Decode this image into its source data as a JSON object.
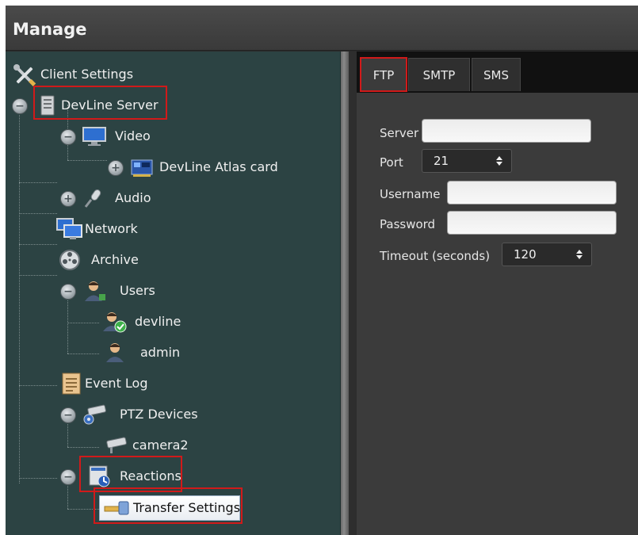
{
  "window": {
    "title": "Manage"
  },
  "tree": {
    "client_settings": "Client Settings",
    "devline_server": "DevLine Server",
    "video": "Video",
    "atlas_card": "DevLine Atlas card",
    "audio": "Audio",
    "network": "Network",
    "archive": "Archive",
    "users": "Users",
    "user_devline": "devline",
    "user_admin": "admin",
    "event_log": "Event Log",
    "ptz_devices": "PTZ Devices",
    "camera2": "camera2",
    "reactions": "Reactions",
    "transfer_settings": "Transfer Settings",
    "toggle_collapse": "−",
    "toggle_expand": "+"
  },
  "tabs": [
    "FTP",
    "SMTP",
    "SMS"
  ],
  "ftp_form": {
    "server_label": "Server",
    "server_value": "",
    "port_label": "Port",
    "port_value": "21",
    "username_label": "Username",
    "username_value": "",
    "password_label": "Password",
    "password_value": "",
    "timeout_label": "Timeout (seconds)",
    "timeout_value": "120"
  },
  "colors": {
    "highlight": "#d11a1a",
    "tree_bg": "#2c4343",
    "panel_bg": "#3b3b3b"
  }
}
